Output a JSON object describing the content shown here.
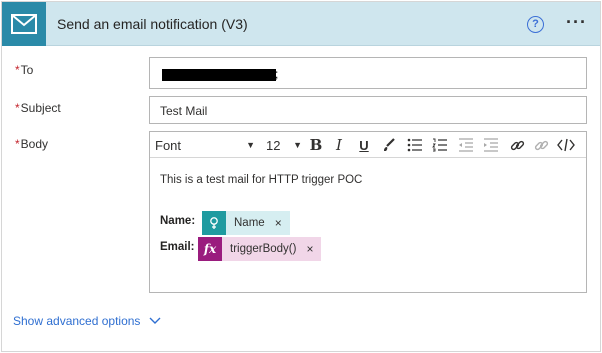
{
  "header": {
    "title": "Send an email notification (V3)",
    "help_glyph": "?",
    "more_glyph": "···",
    "icon": "mail-icon",
    "accent": "#2a8aa8"
  },
  "fields": {
    "to": {
      "label": "To",
      "required": "*",
      "value_suffix": ";"
    },
    "subject": {
      "label": "Subject",
      "required": "*",
      "value": "Test Mail"
    },
    "body": {
      "label": "Body",
      "required": "*"
    }
  },
  "toolbar": {
    "font_label": "Font",
    "size_label": "12",
    "bold": "B",
    "italic": "I",
    "underline": "U",
    "icons": [
      "paint-brush-icon",
      "bullet-list-icon",
      "numbered-list-icon",
      "decrease-indent-icon",
      "increase-indent-icon",
      "link-icon",
      "unlink-icon",
      "code-view-icon"
    ]
  },
  "body_content": {
    "line1": "This is a test mail for HTTP trigger POC",
    "name_label": "Name:",
    "name_token": "Name",
    "email_label": "Email:",
    "email_token": "triggerBody()",
    "email_token_glyph": "fx",
    "token_close": "×"
  },
  "footer": {
    "advanced": "Show advanced options"
  },
  "colors": {
    "required": "#c4262e",
    "link": "#2f6fd1",
    "token_dynamic": "#1f9ba0",
    "token_expression": "#9a1c7e"
  }
}
